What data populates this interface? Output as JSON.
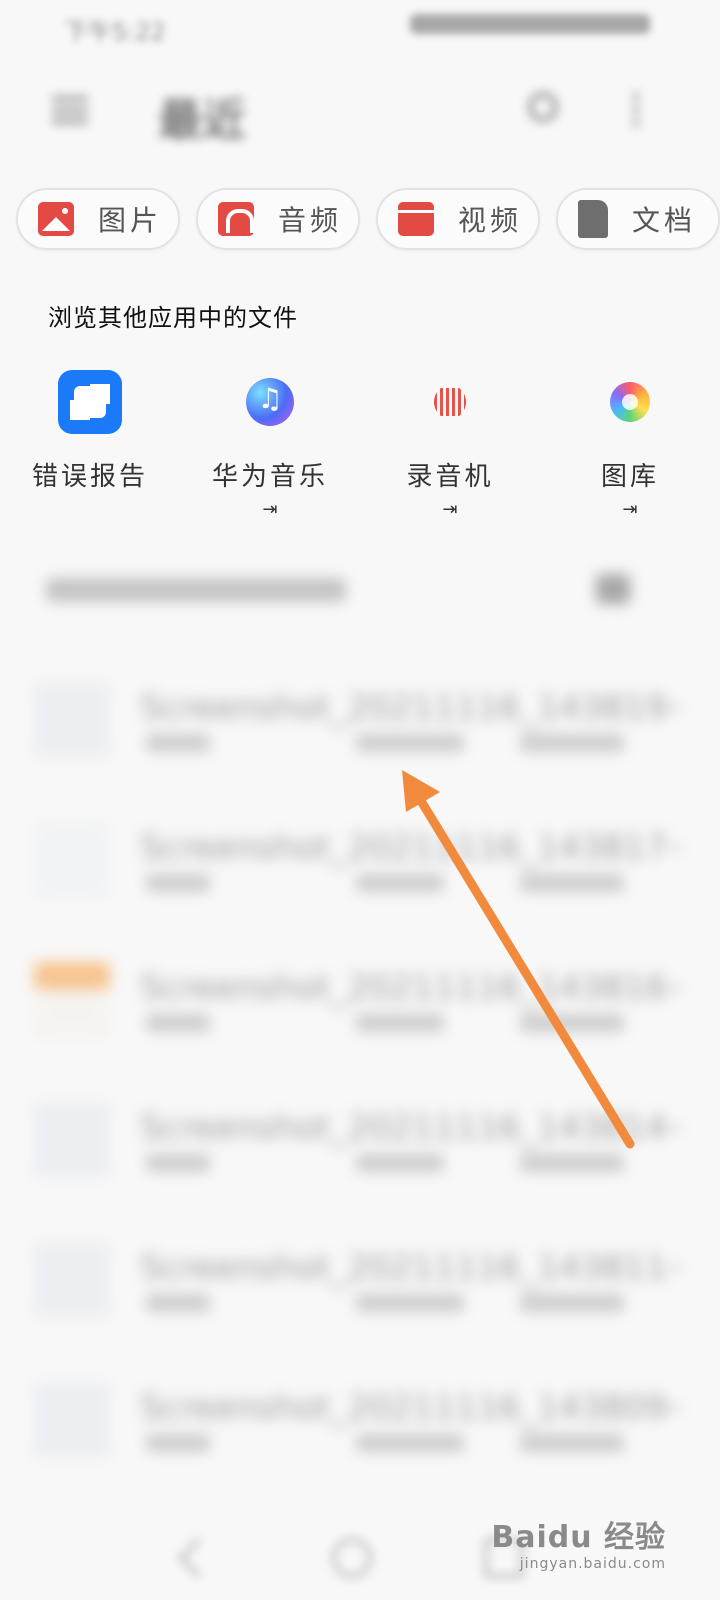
{
  "status_bar": {
    "left_text": "下午5:22"
  },
  "header": {
    "title": "最近"
  },
  "chips": [
    {
      "label": "图片",
      "icon": "image-icon"
    },
    {
      "label": "音频",
      "icon": "headphones-icon"
    },
    {
      "label": "视频",
      "icon": "clapperboard-icon"
    },
    {
      "label": "文档",
      "icon": "document-icon"
    }
  ],
  "browse_section": {
    "title": "浏览其他应用中的文件",
    "apps": [
      {
        "label": "错误报告",
        "icon": "puzzle-icon",
        "external": ""
      },
      {
        "label": "华为音乐",
        "icon": "music-note-icon",
        "external": "⇥"
      },
      {
        "label": "录音机",
        "icon": "sound-wave-icon",
        "external": "⇥"
      },
      {
        "label": "图库",
        "icon": "gallery-flower-icon",
        "external": "⇥"
      }
    ]
  },
  "recent_files": [
    {
      "name": "Screenshot_20211116_143819~"
    },
    {
      "name": "Screenshot_20211116_143817~"
    },
    {
      "name": "Screenshot_20211116_143816~"
    },
    {
      "name": "Screenshot_20211116_143814~"
    },
    {
      "name": "Screenshot_20211116_143811~"
    },
    {
      "name": "Screenshot_20211116_143809~"
    }
  ],
  "watermark": {
    "main": "Baidu 经验",
    "sub": "jingyan.baidu.com"
  },
  "colors": {
    "chip_icon_red": "#e24a43",
    "arrow": "#f18a3c",
    "accent_blue": "#1a7af8"
  }
}
